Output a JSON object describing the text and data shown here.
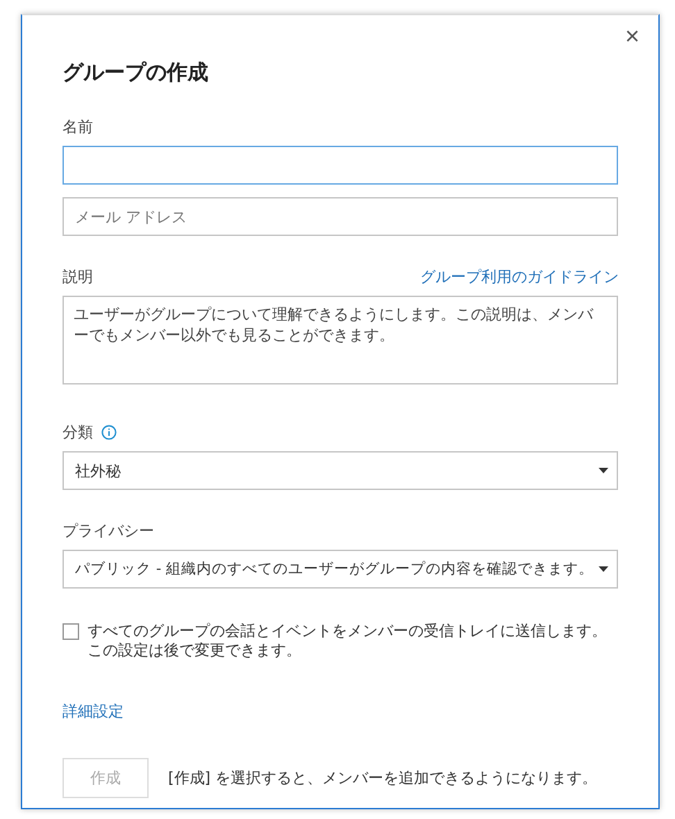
{
  "dialog": {
    "title": "グループの作成",
    "close": "×"
  },
  "name": {
    "label": "名前",
    "focused": true
  },
  "email": {
    "placeholder": "メール アドレス"
  },
  "description": {
    "label": "説明",
    "link": "グループ利用のガイドライン",
    "placeholder": "ユーザーがグループについて理解できるようにします。この説明は、メンバーでもメンバー以外でも見ることができます。"
  },
  "classification": {
    "label": "分類",
    "value": "社外秘"
  },
  "privacy": {
    "label": "プライバシー",
    "value": "パブリック - 組織内のすべてのユーザーがグループの内容を確認できます。"
  },
  "subscribe": {
    "checked": false,
    "text": "すべてのグループの会話とイベントをメンバーの受信トレイに送信します。",
    "note": "この設定は後で変更できます。"
  },
  "advanced_link": "詳細設定",
  "create_button": {
    "label": "作成",
    "disabled": true
  },
  "hint": "[作成] を選択すると、メンバーを追加できるようになります。"
}
